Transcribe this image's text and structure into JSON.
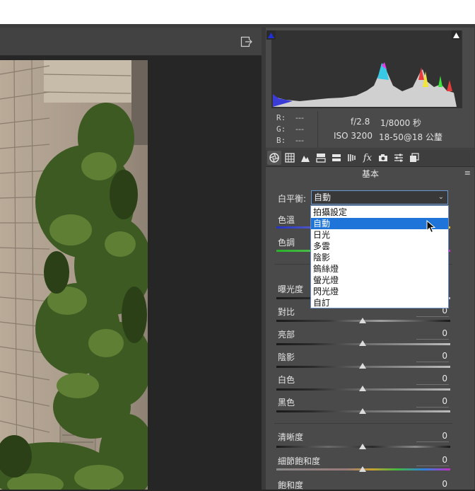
{
  "window": {
    "export_icon": "export-icon"
  },
  "info": {
    "r_label": "R:",
    "g_label": "G:",
    "b_label": "B:",
    "r_value": "---",
    "g_value": "---",
    "b_value": "---",
    "aperture": "f/2.8",
    "shutter": "1/8000 秒",
    "iso": "ISO 3200",
    "lens": "18-50@18 公釐"
  },
  "tabs": [
    "aperture-icon",
    "grid-icon",
    "mountain-icon",
    "split-icon",
    "hsl-icon",
    "detail-icon",
    "fx-icon",
    "camera-icon",
    "sliders-icon",
    "presets-icon"
  ],
  "panel": {
    "title": "基本",
    "menu_icon": "≡"
  },
  "white_balance": {
    "label": "白平衡:",
    "value": "自動",
    "options": [
      "拍攝設定",
      "自動",
      "日光",
      "多雲",
      "陰影",
      "鎢絲燈",
      "螢光燈",
      "閃光燈",
      "自訂"
    ],
    "selected_index": 1
  },
  "sliders": {
    "temp": {
      "label": "色溫"
    },
    "tint": {
      "label": "色調"
    },
    "exposure": {
      "label": "曝光度"
    },
    "contrast": {
      "label": "對比",
      "value": "0"
    },
    "highlights": {
      "label": "亮部",
      "value": "0"
    },
    "shadows": {
      "label": "陰影",
      "value": "0"
    },
    "whites": {
      "label": "白色",
      "value": "0"
    },
    "blacks": {
      "label": "黑色",
      "value": "0"
    },
    "clarity": {
      "label": "清晰度",
      "value": "0"
    },
    "vibrance": {
      "label": "細節飽和度",
      "value": "0"
    },
    "saturation": {
      "label": "飽和度",
      "value": "0"
    }
  },
  "colors": {
    "accent": "#1e74d8",
    "panel_bg": "#4a4a4a",
    "canvas_bg": "#262626"
  }
}
